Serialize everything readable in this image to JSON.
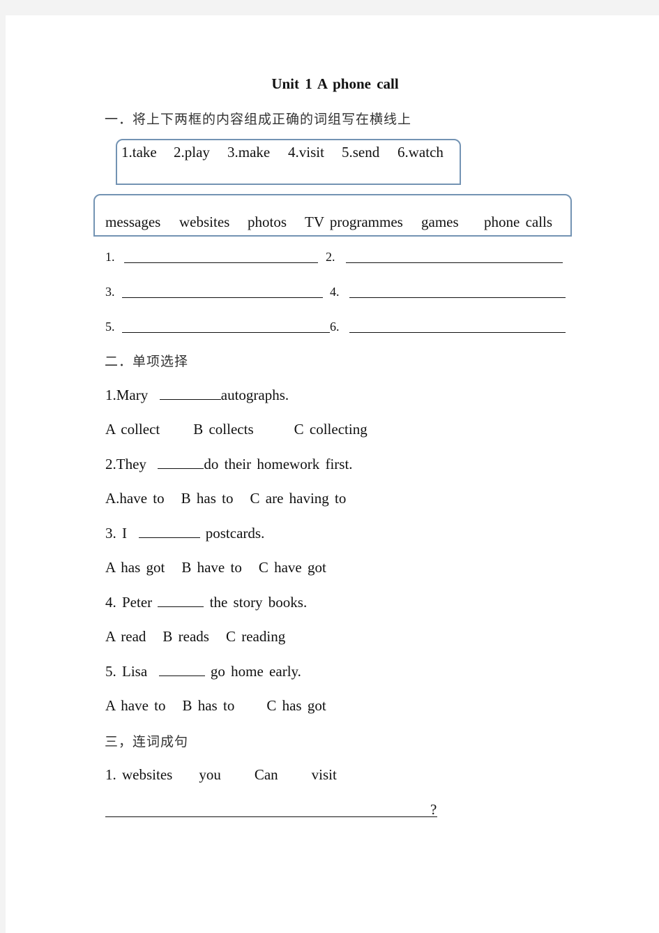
{
  "title": "Unit 1 A phone call",
  "section1": {
    "heading": "一．将上下两框的内容组成正确的词组写在横线上",
    "verbs": [
      "1.take",
      "2.play",
      "3.make",
      "4.visit",
      "5.send",
      "6.watch"
    ],
    "nouns": [
      "messages",
      "websites",
      "photos",
      "TV programmes",
      "games",
      "phone calls"
    ],
    "answer_labels": [
      "1.",
      "2.",
      "3.",
      "4.",
      "5.",
      "6."
    ]
  },
  "section2": {
    "heading": "二．单项选择",
    "questions": [
      {
        "number": "1.",
        "before": "Mary ",
        "after": "autographs.",
        "options": [
          "A collect",
          "B collects",
          "C collecting"
        ]
      },
      {
        "number": "2.",
        "before": "They ",
        "after": "do their homework first.",
        "options": [
          "A.have to",
          "B has to",
          "C are having to"
        ]
      },
      {
        "number": "3.",
        "before": " I ",
        "after": " postcards.",
        "options": [
          "A has got",
          "B have to",
          "C have got"
        ]
      },
      {
        "number": "4.",
        "before": " Peter ",
        "after": " the story books.",
        "options": [
          "A read",
          "B reads",
          "C reading"
        ]
      },
      {
        "number": "5.",
        "before": " Lisa ",
        "after": " go home early.",
        "options": [
          "A have to",
          "B has to",
          "C has got"
        ]
      }
    ]
  },
  "section3": {
    "heading": "三，连词成句",
    "items": [
      {
        "number": "1.",
        "words": [
          "websites",
          "you",
          "Can",
          "visit"
        ],
        "end_punct": "?"
      }
    ]
  }
}
